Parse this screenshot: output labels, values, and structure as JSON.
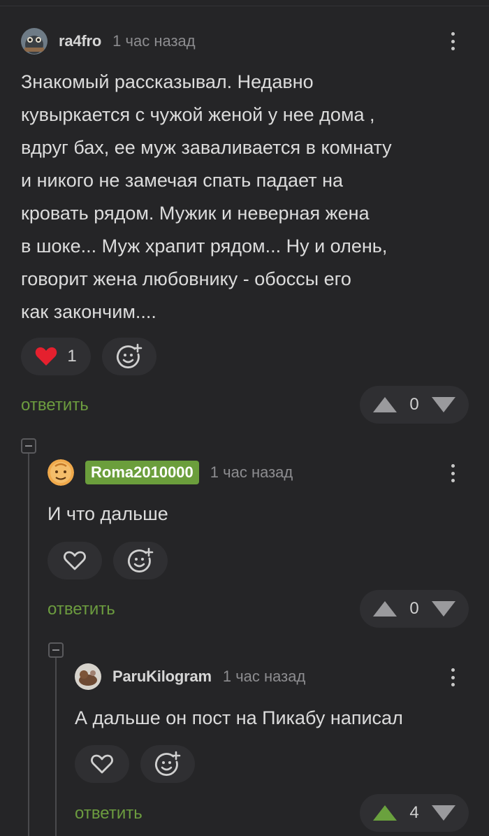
{
  "comments": [
    {
      "author": "ra4fro",
      "time": "1 час назад",
      "text_lines": [
        "Знакомый рассказывал. Недавно",
        "кувыркается с чужой женой у нее дома ,",
        "вдруг бах, ее муж заваливается в комнату",
        "и никого не замечая спать падает на",
        "кровать рядом. Мужик и неверная жена",
        "в шоке... Муж храпит рядом... Ну и олень,",
        "говорит жена любовнику - обоссы его",
        "как закончим...."
      ],
      "like_count": "1",
      "reply_label": "ответить",
      "score": "0"
    },
    {
      "author": "Roma2010000",
      "time": "1 час назад",
      "text": "И что дальше",
      "reply_label": "ответить",
      "score": "0"
    },
    {
      "author": "ParuKilogram",
      "time": "1 час назад",
      "text": "А дальше он пост на Пикабу написал",
      "reply_label": "ответить",
      "score": "4"
    }
  ],
  "colors": {
    "background": "#252527",
    "accent_green": "#6c9c3f",
    "badge_green": "#6b9e3c",
    "like_red": "#e5202e",
    "upvote_active": "#6aa13e",
    "muted": "#8d8d90"
  },
  "icons": [
    "kebab-menu-icon",
    "heart-icon",
    "add-reaction-icon",
    "upvote-icon",
    "downvote-icon",
    "collapse-icon"
  ]
}
